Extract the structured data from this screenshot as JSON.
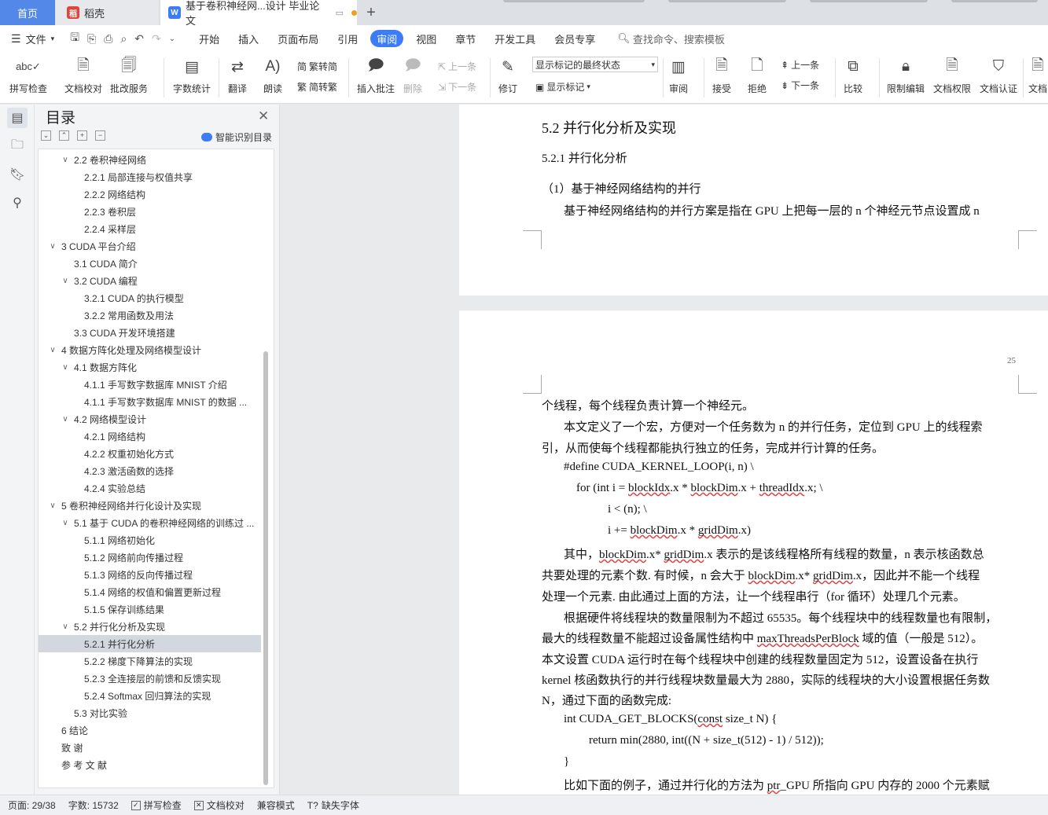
{
  "tabs": {
    "home": "首页",
    "daoke": "稻壳",
    "document": "基于卷积神经网...设计 毕业论文",
    "plus": "+"
  },
  "menubar": {
    "file": "文件",
    "items": [
      "开始",
      "插入",
      "页面布局",
      "引用",
      "审阅",
      "视图",
      "章节",
      "开发工具",
      "会员专享"
    ],
    "active": "审阅",
    "search": "查找命令、搜索模板"
  },
  "ribbon": {
    "spellcheck": "拼写检查",
    "doc_proof": "文档校对",
    "review_service": "批改服务",
    "word_count": "字数统计",
    "translate": "翻译",
    "read_aloud": "朗读",
    "trad_to_simp": "繁转简",
    "simp_to_trad": "简转繁",
    "insert_comment": "插入批注",
    "delete": "删除",
    "prev_comment": "上一条",
    "next_comment": "下一条",
    "track_changes": "修订",
    "markup_mode": "显示标记的最终状态",
    "show_markup": "显示标记",
    "review_pane": "审阅",
    "accept": "接受",
    "reject": "拒绝",
    "prev_change": "上一条",
    "next_change": "下一条",
    "compare": "比较",
    "restrict_edit": "限制编辑",
    "doc_permission": "文档权限",
    "doc_cert": "文档认证",
    "doc_more": "文档"
  },
  "toc": {
    "title": "目录",
    "smart": "智能识别目录",
    "items": [
      {
        "label": "2.2 卷积神经网络",
        "level": 1,
        "expand": true
      },
      {
        "label": "2.2.1 局部连接与权值共享",
        "level": 2
      },
      {
        "label": "2.2.2 网络结构",
        "level": 2
      },
      {
        "label": "2.2.3 卷积层",
        "level": 2
      },
      {
        "label": "2.2.4 采样层",
        "level": 2
      },
      {
        "label": "3 CUDA 平台介绍",
        "level": 0,
        "expand": true
      },
      {
        "label": "3.1 CUDA 简介",
        "level": 1
      },
      {
        "label": "3.2 CUDA 编程",
        "level": 1,
        "expand": true
      },
      {
        "label": "3.2.1 CUDA 的执行模型",
        "level": 2
      },
      {
        "label": "3.2.2 常用函数及用法",
        "level": 2
      },
      {
        "label": "3.3 CUDA 开发环境搭建",
        "level": 1
      },
      {
        "label": "4 数据方阵化处理及网络模型设计",
        "level": 0,
        "expand": true
      },
      {
        "label": "4.1 数据方阵化",
        "level": 1,
        "expand": true
      },
      {
        "label": "4.1.1 手写数字数据库 MNIST 介绍",
        "level": 2
      },
      {
        "label": "4.1.1 手写数字数据库 MNIST 的数据 ...",
        "level": 2
      },
      {
        "label": "4.2 网络模型设计",
        "level": 1,
        "expand": true
      },
      {
        "label": "4.2.1 网络结构",
        "level": 2
      },
      {
        "label": "4.2.2 权重初始化方式",
        "level": 2
      },
      {
        "label": "4.2.3 激活函数的选择",
        "level": 2
      },
      {
        "label": "4.2.4 实验总结",
        "level": 2
      },
      {
        "label": "5 卷积神经网络并行化设计及实现",
        "level": 0,
        "expand": true
      },
      {
        "label": "5.1 基于 CUDA 的卷积神经网络的训练过 ...",
        "level": 1,
        "expand": true
      },
      {
        "label": "5.1.1 网络初始化",
        "level": 2
      },
      {
        "label": "5.1.2 网络前向传播过程",
        "level": 2
      },
      {
        "label": "5.1.3 网络的反向传播过程",
        "level": 2
      },
      {
        "label": "5.1.4 网络的权值和偏置更新过程",
        "level": 2
      },
      {
        "label": "5.1.5 保存训练结果",
        "level": 2
      },
      {
        "label": "5.2 并行化分析及实现",
        "level": 1,
        "expand": true
      },
      {
        "label": "5.2.1 并行化分析",
        "level": 2,
        "selected": true
      },
      {
        "label": "5.2.2 梯度下降算法的实现",
        "level": 2
      },
      {
        "label": "5.2.3 全连接层的前馈和反馈实现",
        "level": 2
      },
      {
        "label": "5.2.4 Softmax 回归算法的实现",
        "level": 2
      },
      {
        "label": "5.3 对比实验",
        "level": 1
      },
      {
        "label": "6 结论",
        "level": 0
      },
      {
        "label": "致 谢",
        "level": 0
      },
      {
        "label": "参 考 文 献",
        "level": 0
      }
    ]
  },
  "document": {
    "page1": {
      "heading2": "5.2  并行化分析及实现",
      "heading3": "5.2.1  并行化分析",
      "sub": "（1）基于神经网络结构的并行",
      "para": "基于神经网络结构的并行方案是指在 GPU 上把每一层的 n 个神经元节点设置成 n"
    },
    "page2": {
      "page_number": "25",
      "l1": "个线程，每个线程负责计算一个神经元。",
      "l2": "本文定义了一个宏，方便对一个任务数为 n 的并行任务，定位到 GPU 上的线程索",
      "l3": "引，从而使每个线程都能执行独立的任务，完成并行计算的任务。",
      "c1": "#define CUDA_KERNEL_LOOP(i, n) \\",
      "c2a": "for (int i = ",
      "c2b": "blockIdx",
      "c2c": ".x * ",
      "c2d": "blockDim",
      "c2e": ".x + ",
      "c2f": "threadIdx",
      "c2g": ".x; \\",
      "c3": "i < (n); \\",
      "c4a": "i += ",
      "c4b": "blockDim",
      "c4c": ".x * ",
      "c4d": "gridDim",
      "c4e": ".x)",
      "l5a": "其中，",
      "l5b": "blockDim",
      "l5c": ".x* ",
      "l5d": "gridDim",
      "l5e": ".x 表示的是该线程格所有线程的数量，n 表示核函数总",
      "l6a": "共要处理的元素个数. 有时候，n 会大于 ",
      "l6b": "blockDim",
      "l6c": ".x* ",
      "l6d": "gridDim",
      "l6e": ".x，因此并不能一个线程",
      "l7": "处理一个元素. 由此通过上面的方法，让一个线程串行（for 循环）处理几个元素。",
      "l8": "根据硬件将线程块的数量限制为不超过 65535。每个线程块中的线程数量也有限制，",
      "l9a": "最大的线程数量不能超过设备属性结构中 ",
      "l9b": "maxThreadsPerBlock",
      "l9c": " 域的值（一般是 512）。",
      "l10": "本文设置 CUDA 运行时在每个线程块中创建的线程数量固定为 512，设置设备在执行",
      "l11": "kernel 核函数执行的并行线程块数量最大为 2880，实际的线程块的大小设置根据任务数",
      "l12": "N，通过下面的函数完成:",
      "c5a": "int CUDA_GET_BLOCKS(",
      "c5b": "const",
      "c5c": " size_t N) {",
      "c6": "return min(2880, int((N + size_t(512) - 1) / 512));",
      "c7": "}",
      "l13a": "比如下面的例子，通过并行化的方法为 ",
      "l13b": "ptr",
      "l13c": "_GPU 所指向 GPU 内存的 2000 个元素赋"
    }
  },
  "status": {
    "page": "页面: 29/38",
    "words": "字数: 15732",
    "spell": "拼写检查",
    "proof": "文档校对",
    "compat": "兼容模式",
    "missing_font": "缺失字体"
  }
}
